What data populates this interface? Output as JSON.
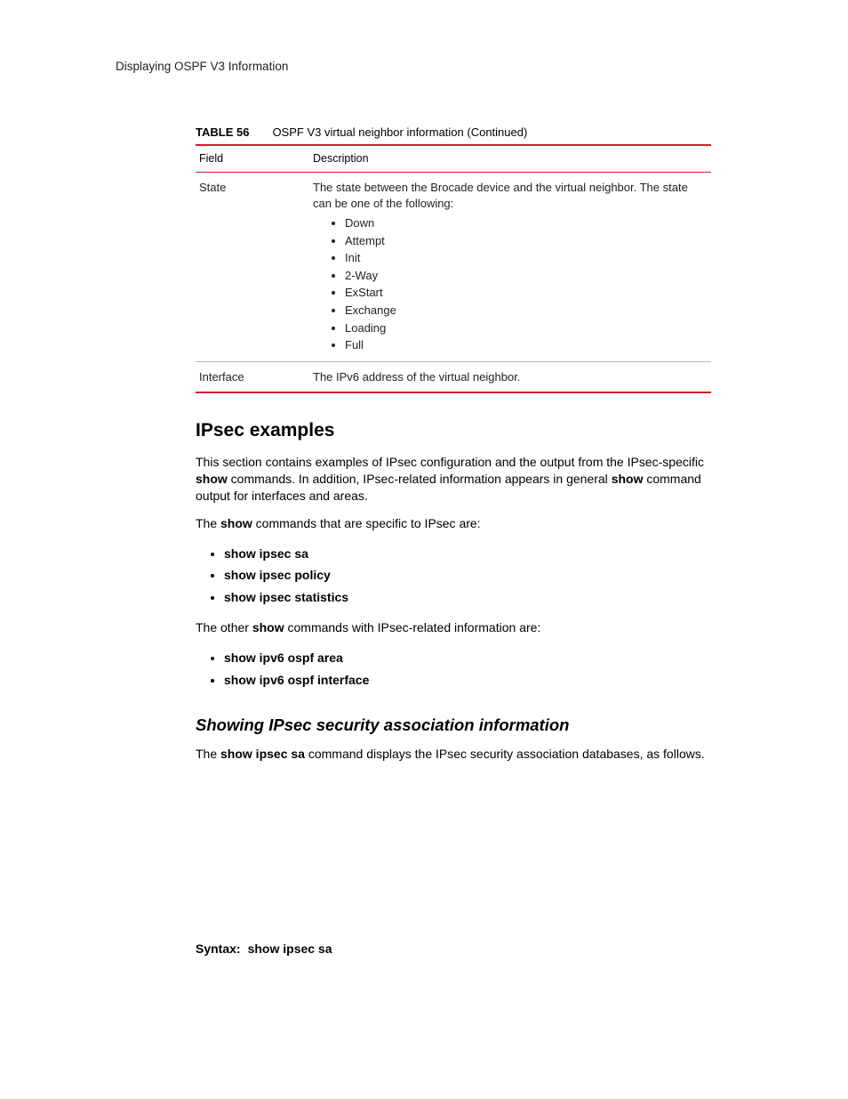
{
  "running_head": "Displaying OSPF V3 Information",
  "table": {
    "label": "TABLE 56",
    "caption": "OSPF V3 virtual neighbor information (Continued)",
    "head_field": "Field",
    "head_desc": "Description",
    "rows": [
      {
        "field": "State",
        "desc_intro": "The state between the Brocade device and the virtual neighbor. The state can be one of the following:",
        "items": [
          "Down",
          "Attempt",
          "Init",
          "2-Way",
          "ExStart",
          "Exchange",
          "Loading",
          "Full"
        ]
      },
      {
        "field": "Interface",
        "desc_intro": "The IPv6 address of the virtual neighbor.",
        "items": []
      }
    ]
  },
  "sections": {
    "ipsec_title": "IPsec examples",
    "para1_a": "This section contains examples of IPsec configuration and the output from the IPsec-specific ",
    "para1_show": "show",
    "para1_b": " commands. In addition, IPsec-related information appears in general ",
    "para1_show2": "show",
    "para1_c": " command output for interfaces and areas.",
    "para2_a": "The ",
    "para2_show": "show",
    "para2_b": " commands that are specific to IPsec are:",
    "list1": [
      "show ipsec sa",
      "show ipsec policy",
      "show ipsec statistics"
    ],
    "para3_a": "The other ",
    "para3_show": "show",
    "para3_b": " commands with IPsec-related information are:",
    "list2": [
      "show ipv6 ospf area",
      "show ipv6 ospf interface"
    ],
    "subsection_title": "Showing IPsec security association information",
    "para4_a": "The ",
    "para4_cmd": "show ipsec sa",
    "para4_b": " command displays the IPsec security association databases, as follows.",
    "syntax_label": "Syntax:",
    "syntax_cmd": "show ipsec sa"
  }
}
